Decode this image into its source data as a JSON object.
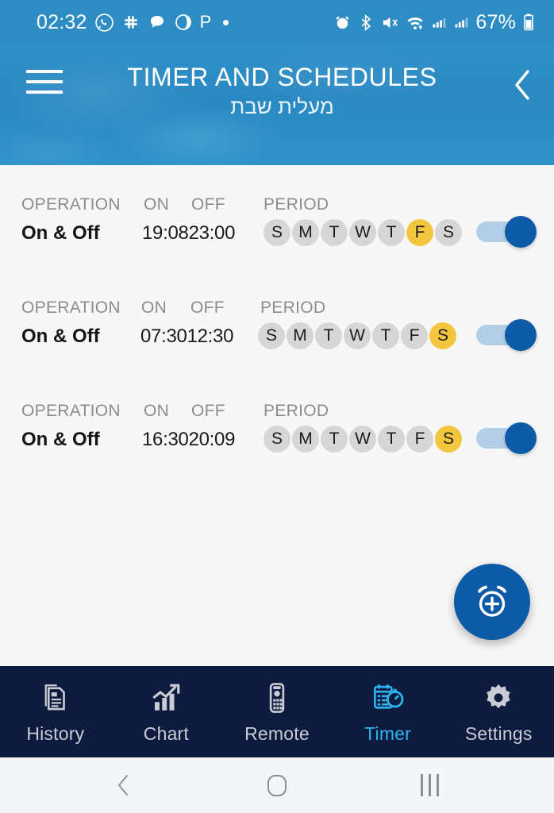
{
  "status_bar": {
    "clock": "02:32",
    "battery_percent": "67%",
    "left_icons": [
      "whatsapp-icon",
      "slack-icon",
      "message-icon",
      "music-icon",
      "parking-icon",
      "dot-icon"
    ],
    "right_icons": [
      "alarm-icon",
      "bluetooth-icon",
      "mute-vibrate-icon",
      "wifi-icon",
      "signal-sim1-icon",
      "signal-sim2-icon",
      "battery-icon"
    ],
    "background_color": "#2e8cc4"
  },
  "header": {
    "menu_icon": "hamburger-icon",
    "title": "TIMER AND SCHEDULES",
    "subtitle": "מעלית שבת",
    "back_icon": "chevron-left-icon",
    "background_color": "#2a89c2"
  },
  "columns": {
    "operation": "OPERATION",
    "on": "ON",
    "off": "OFF",
    "period": "PERIOD"
  },
  "day_initials": [
    "S",
    "M",
    "T",
    "W",
    "T",
    "F",
    "S"
  ],
  "colors": {
    "accent_blue": "#0d5aa7",
    "toggle_track": "#b3cfe8",
    "day_inactive": "#d6d6d6",
    "day_active": "#f3c63f",
    "nav_background": "#0d1b3e",
    "nav_active": "#2fb3ef",
    "content_background": "#f7f7f7"
  },
  "schedules": [
    {
      "operation": "On & Off",
      "on_time": "19:08",
      "off_time": "23:00",
      "days_active": [
        false,
        false,
        false,
        false,
        false,
        true,
        false
      ],
      "enabled": true
    },
    {
      "operation": "On & Off",
      "on_time": "07:30",
      "off_time": "12:30",
      "days_active": [
        false,
        false,
        false,
        false,
        false,
        false,
        true
      ],
      "enabled": true
    },
    {
      "operation": "On & Off",
      "on_time": "16:30",
      "off_time": "20:09",
      "days_active": [
        false,
        false,
        false,
        false,
        false,
        false,
        true
      ],
      "enabled": true
    }
  ],
  "fab": {
    "icon": "alarm-add-icon",
    "label": "Add timer"
  },
  "bottom_nav": {
    "items": [
      {
        "label": "History",
        "icon": "history-document-icon",
        "active": false
      },
      {
        "label": "Chart",
        "icon": "chart-trend-icon",
        "active": false
      },
      {
        "label": "Remote",
        "icon": "remote-control-icon",
        "active": false
      },
      {
        "label": "Timer",
        "icon": "timer-schedule-icon",
        "active": true
      },
      {
        "label": "Settings",
        "icon": "gear-icon",
        "active": false
      }
    ]
  },
  "android_nav": {
    "back": "back-chevron-icon",
    "home": "home-icon",
    "recents": "recents-icon"
  }
}
